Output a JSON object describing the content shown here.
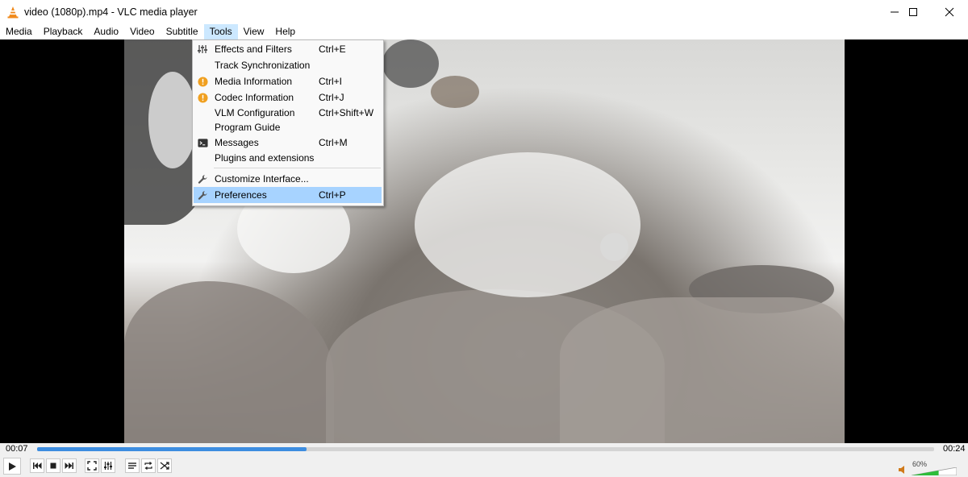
{
  "window": {
    "title": "video (1080p).mp4 - VLC media player"
  },
  "menubar": {
    "items": [
      "Media",
      "Playback",
      "Audio",
      "Video",
      "Subtitle",
      "Tools",
      "View",
      "Help"
    ],
    "active": "Tools"
  },
  "tools_menu": {
    "items": [
      {
        "label": "Effects and Filters",
        "shortcut": "Ctrl+E",
        "icon": "equalizer-icon"
      },
      {
        "label": "Track Synchronization",
        "shortcut": "",
        "icon": ""
      },
      {
        "label": "Media Information",
        "shortcut": "Ctrl+I",
        "icon": "info-icon"
      },
      {
        "label": "Codec Information",
        "shortcut": "Ctrl+J",
        "icon": "info-icon"
      },
      {
        "label": "VLM Configuration",
        "shortcut": "Ctrl+Shift+W",
        "icon": ""
      },
      {
        "label": "Program Guide",
        "shortcut": "",
        "icon": ""
      },
      {
        "label": "Messages",
        "shortcut": "Ctrl+M",
        "icon": "terminal-icon"
      },
      {
        "label": "Plugins and extensions",
        "shortcut": "",
        "icon": ""
      },
      {
        "label": "Customize Interface...",
        "shortcut": "",
        "icon": "wrench-icon"
      },
      {
        "label": "Preferences",
        "shortcut": "Ctrl+P",
        "icon": "wrench-icon",
        "highlighted": true
      }
    ]
  },
  "playback": {
    "elapsed": "00:07",
    "total": "00:24",
    "progress_fraction": 0.3
  },
  "volume": {
    "label": "60%",
    "level_fraction": 0.6
  },
  "colors": {
    "accent": "#3d8de0",
    "menu_highlight": "#a7d3ff",
    "info_orange": "#f0a020",
    "volume_green": "#2ebd3a"
  }
}
